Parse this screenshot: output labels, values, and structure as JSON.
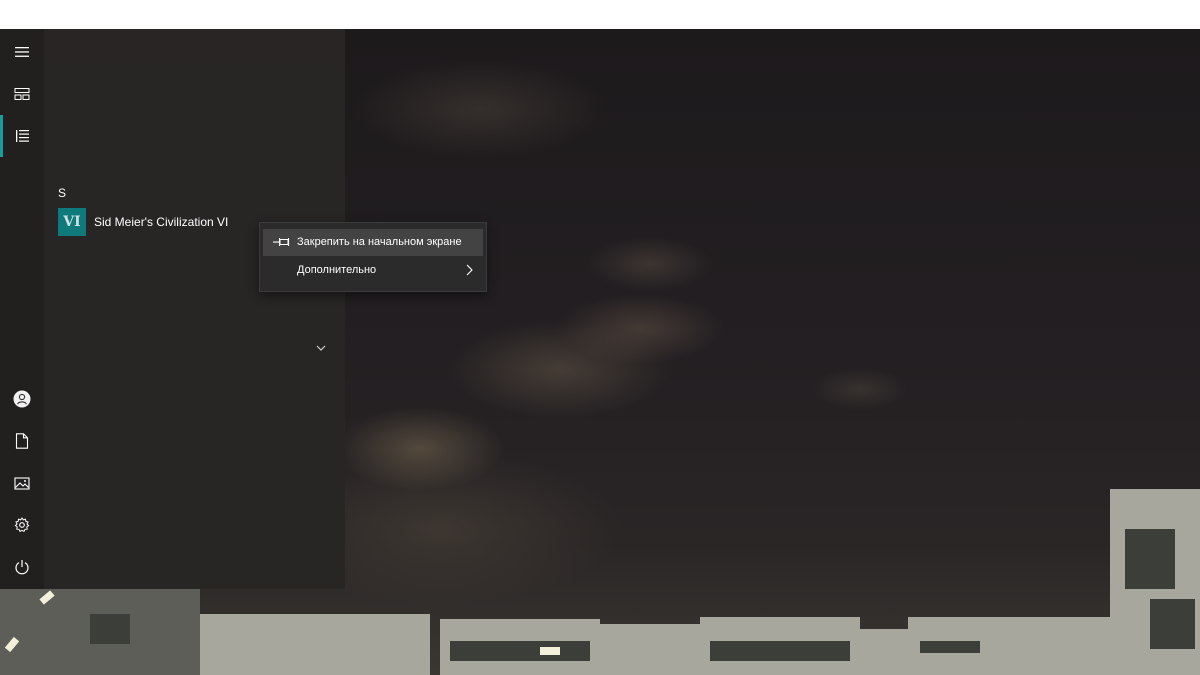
{
  "start_menu": {
    "group_letter": "S",
    "app": {
      "tile_text": "VI",
      "name": "Sid Meier's Civilization VI"
    },
    "rail": {
      "top_icons": [
        "hamburger-menu-icon",
        "tiles-icon",
        "all-apps-list-icon"
      ],
      "bottom_icons": [
        "user-icon",
        "documents-icon",
        "pictures-icon",
        "settings-icon",
        "power-icon"
      ]
    }
  },
  "context_menu": {
    "items": [
      {
        "label": "Закрепить на начальном экране",
        "icon": "pin-icon"
      },
      {
        "label": "Дополнительно",
        "icon": "chevron-right-icon"
      }
    ]
  },
  "colors": {
    "accent": "#1a9ba0",
    "tile": "#0f7a7c",
    "menu_bg": "#282625",
    "context_bg": "#2b2b2b"
  }
}
